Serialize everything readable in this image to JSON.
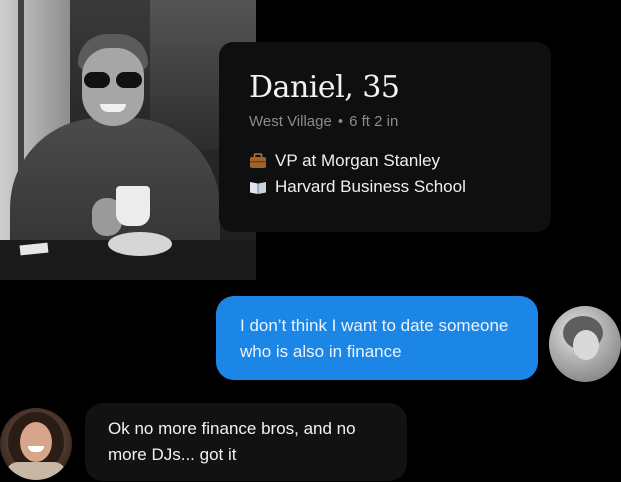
{
  "profile": {
    "name_age": "Daniel, 35",
    "location": "West Village",
    "separator": "•",
    "height": "6 ft 2 in",
    "job": "VP at Morgan Stanley",
    "school": "Harvard Business School",
    "job_icon": "briefcase-icon",
    "school_icon": "book-icon"
  },
  "messages": {
    "outgoing": "I don’t think I want to date someone who is also in finance",
    "incoming": "Ok no more finance bros, and no more DJs... got it"
  },
  "colors": {
    "outgoing_bubble": "#1b86e6",
    "incoming_bubble": "#121212",
    "card_bg": "#0f0f0f",
    "page_bg": "#000000"
  }
}
